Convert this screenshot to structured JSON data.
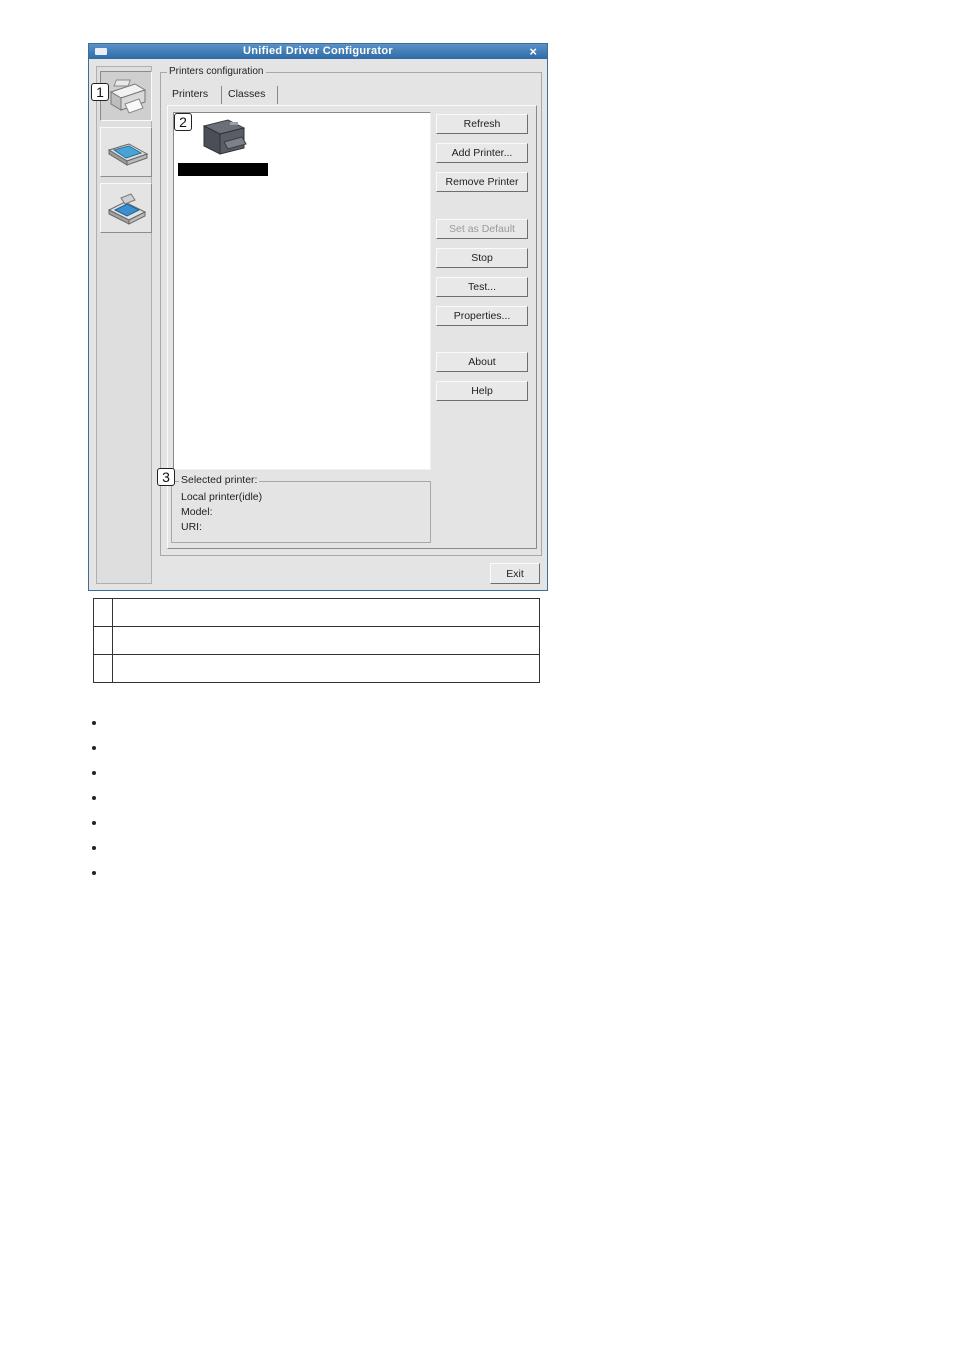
{
  "window": {
    "title": "Unified Driver Configurator",
    "close_glyph": "×"
  },
  "sidebar": {
    "items": [
      {
        "name": "printers-config",
        "icon": "printer-icon",
        "active": true
      },
      {
        "name": "scanners-config",
        "icon": "scanner-icon",
        "active": false
      },
      {
        "name": "ports-config",
        "icon": "port-icon",
        "active": false
      }
    ]
  },
  "callouts": [
    "1",
    "2",
    "3"
  ],
  "group": {
    "label": "Printers configuration",
    "tabs": [
      "Printers",
      "Classes"
    ]
  },
  "buttons": {
    "refresh": "Refresh",
    "add_printer": "Add Printer...",
    "remove_printer": "Remove Printer",
    "set_as_default": "Set as Default",
    "stop": "Stop",
    "test": "Test...",
    "properties": "Properties...",
    "about": "About",
    "help": "Help",
    "exit": "Exit"
  },
  "selected_printer": {
    "label": "Selected printer:",
    "status": "Local printer(idle)",
    "model_label": "Model:",
    "uri_label": "URI:"
  },
  "colors": {
    "titlebar": "#2e6aa6",
    "window_bg": "#e4e4e4"
  }
}
